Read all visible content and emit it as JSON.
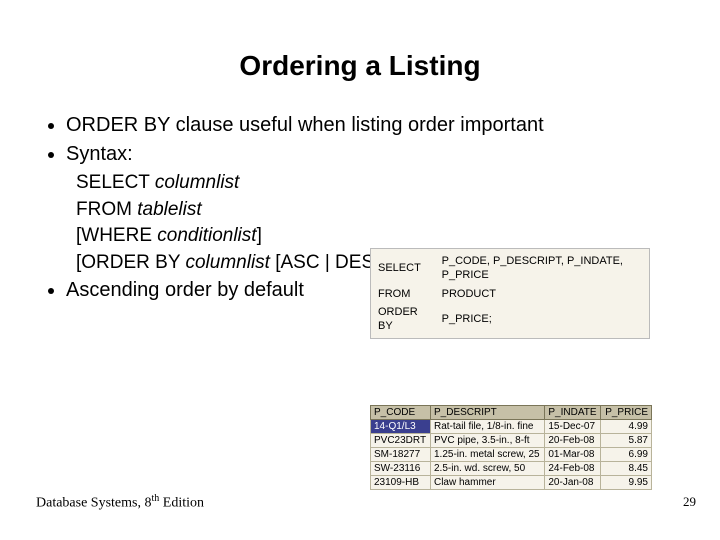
{
  "title": "Ordering a Listing",
  "bullets": {
    "b1": "ORDER BY clause useful when listing order important",
    "b2": "Syntax:",
    "b3": "Ascending order by default"
  },
  "syntax": {
    "l1a": "SELECT ",
    "l1b": "columnlist",
    "l2a": "FROM ",
    "l2b": "tablelist",
    "l3a": "[WHERE ",
    "l3b": "conditionlist",
    "l3c": "]",
    "l4a": "[ORDER BY ",
    "l4b": "columnlist ",
    "l4c": "[ASC | DESC]];"
  },
  "sql": {
    "r1k": "SELECT",
    "r1v": "P_CODE, P_DESCRIPT, P_INDATE, P_PRICE",
    "r2k": "FROM",
    "r2v": "PRODUCT",
    "r3k": "ORDER BY",
    "r3v": "P_PRICE;"
  },
  "table": {
    "headers": [
      "P_CODE",
      "P_DESCRIPT",
      "P_INDATE",
      "P_PRICE"
    ],
    "rows": [
      [
        "14-Q1/L3",
        "Rat-tail file, 1/8-in. fine",
        "15-Dec-07",
        "4.99"
      ],
      [
        "PVC23DRT",
        "PVC pipe, 3.5-in., 8-ft",
        "20-Feb-08",
        "5.87"
      ],
      [
        "SM-18277",
        "1.25-in. metal screw, 25",
        "01-Mar-08",
        "6.99"
      ],
      [
        "SW-23116",
        "2.5-in. wd. screw, 50",
        "24-Feb-08",
        "8.45"
      ],
      [
        "23109-HB",
        "Claw hammer",
        "20-Jan-08",
        "9.95"
      ]
    ]
  },
  "footer": {
    "book": "Database Systems, 8",
    "sup": "th",
    "ed": " Edition"
  },
  "pagenum": "29"
}
